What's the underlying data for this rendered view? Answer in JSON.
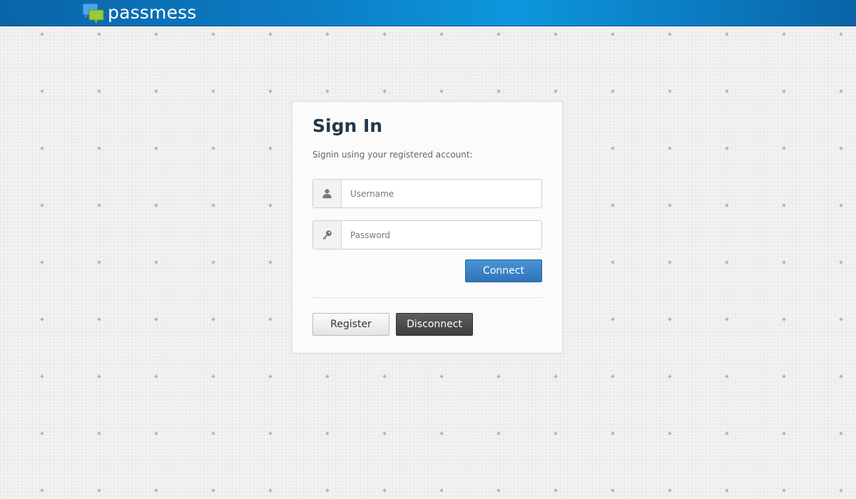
{
  "header": {
    "brand": "passmess",
    "logo_icon": "chat-bubbles-icon",
    "colors": {
      "bar": "#0c7cc4",
      "bubble_blue": "#3fa1e8",
      "bubble_green": "#8cc63f"
    }
  },
  "signin": {
    "title": "Sign In",
    "subtitle": "Signin using your registered account:",
    "username": {
      "icon": "user-icon",
      "placeholder": "Username",
      "value": ""
    },
    "password": {
      "icon": "key-icon",
      "placeholder": "Password",
      "value": ""
    },
    "connect_label": "Connect",
    "register_label": "Register",
    "disconnect_label": "Disconnect",
    "colors": {
      "title": "#253748",
      "connect": "#3a82c4",
      "disconnect": "#4a4a4a"
    }
  }
}
